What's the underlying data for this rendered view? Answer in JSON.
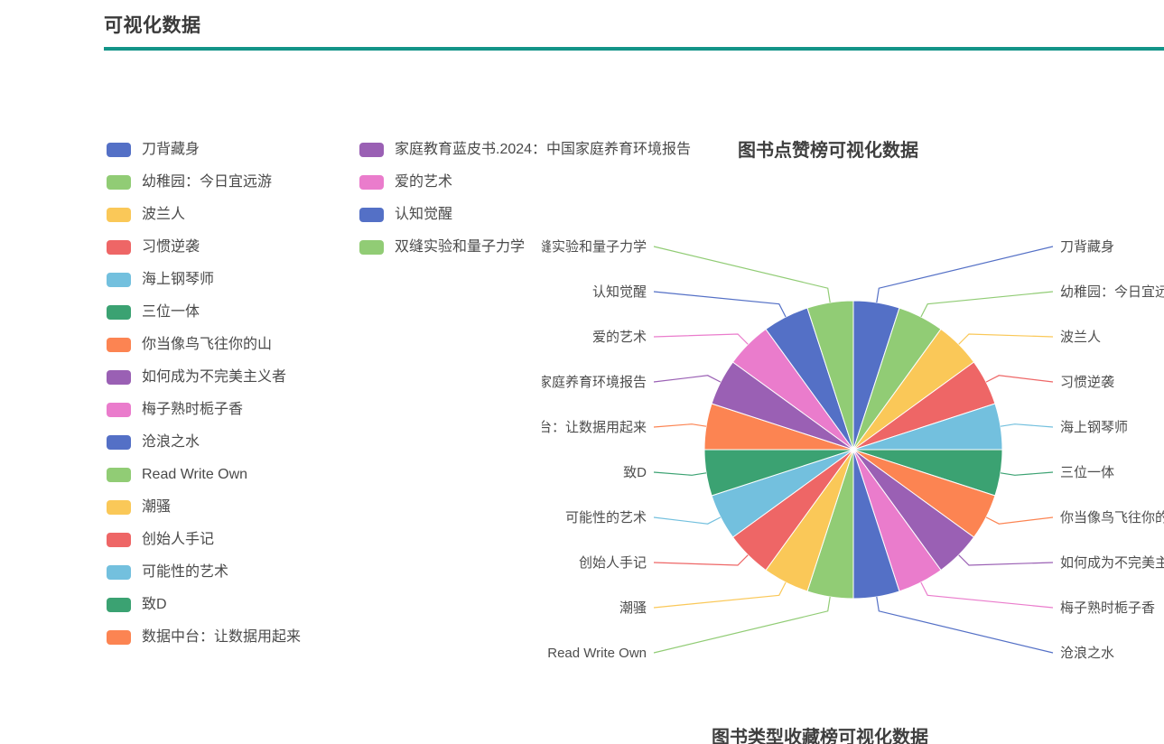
{
  "header": {
    "title": "可视化数据",
    "rule_color": "#139488"
  },
  "legend": {
    "columns": [
      {
        "items": [
          {
            "label": "刀背藏身",
            "color": "#5470c6"
          },
          {
            "label": "幼稚园：今日宜远游",
            "color": "#91cc75"
          },
          {
            "label": "波兰人",
            "color": "#fac858"
          },
          {
            "label": "习惯逆袭",
            "color": "#ee6666"
          },
          {
            "label": "海上钢琴师",
            "color": "#73c0de"
          },
          {
            "label": "三位一体",
            "color": "#3ba272"
          },
          {
            "label": "你当像鸟飞往你的山",
            "color": "#fc8452"
          },
          {
            "label": "如何成为不完美主义者",
            "color": "#9a60b4"
          },
          {
            "label": "梅子熟时栀子香",
            "color": "#ea7ccc"
          },
          {
            "label": "沧浪之水",
            "color": "#5470c6"
          },
          {
            "label": "Read Write Own",
            "color": "#91cc75"
          },
          {
            "label": "潮骚",
            "color": "#fac858"
          },
          {
            "label": "创始人手记",
            "color": "#ee6666"
          },
          {
            "label": "可能性的艺术",
            "color": "#73c0de"
          },
          {
            "label": "致D",
            "color": "#3ba272"
          },
          {
            "label": "数据中台：让数据用起来",
            "color": "#fc8452"
          }
        ]
      },
      {
        "items": [
          {
            "label": "家庭教育蓝皮书.2024：中国家庭养育环境报告",
            "color": "#9a60b4"
          },
          {
            "label": "爱的艺术",
            "color": "#ea7ccc"
          },
          {
            "label": "认知觉醒",
            "color": "#5470c6"
          },
          {
            "label": "双缝实验和量子力学",
            "color": "#91cc75"
          }
        ]
      }
    ]
  },
  "chart_data": {
    "type": "pie",
    "title": "图书点赞榜可视化数据",
    "xlabel": "",
    "ylabel": "",
    "legend_position": "top-left",
    "start_angle": 90,
    "direction": "clockwise",
    "label_line": true,
    "categories": [
      "刀背藏身",
      "幼稚园：今日宜远游",
      "波兰人",
      "习惯逆袭",
      "海上钢琴师",
      "三位一体",
      "你当像鸟飞往你的山",
      "如何成为不完美主义者",
      "梅子熟时栀子香",
      "沧浪之水",
      "Read Write Own",
      "潮骚",
      "创始人手记",
      "可能性的艺术",
      "致D",
      "数据中台：让数据用起来",
      "家庭教育蓝皮书.2024：中国家庭养育环境报告",
      "爱的艺术",
      "认知觉醒",
      "双缝实验和量子力学"
    ],
    "values": [
      1,
      1,
      1,
      1,
      1,
      1,
      1,
      1,
      1,
      1,
      1,
      1,
      1,
      1,
      1,
      1,
      1,
      1,
      1,
      1
    ],
    "colors": [
      "#5470c6",
      "#91cc75",
      "#fac858",
      "#ee6666",
      "#73c0de",
      "#3ba272",
      "#fc8452",
      "#9a60b4",
      "#ea7ccc",
      "#5470c6",
      "#91cc75",
      "#fac858",
      "#ee6666",
      "#73c0de",
      "#3ba272",
      "#fc8452",
      "#9a60b4",
      "#ea7ccc",
      "#5470c6",
      "#91cc75"
    ]
  },
  "chart_2": {
    "title": "图书类型收藏榜可视化数据"
  }
}
